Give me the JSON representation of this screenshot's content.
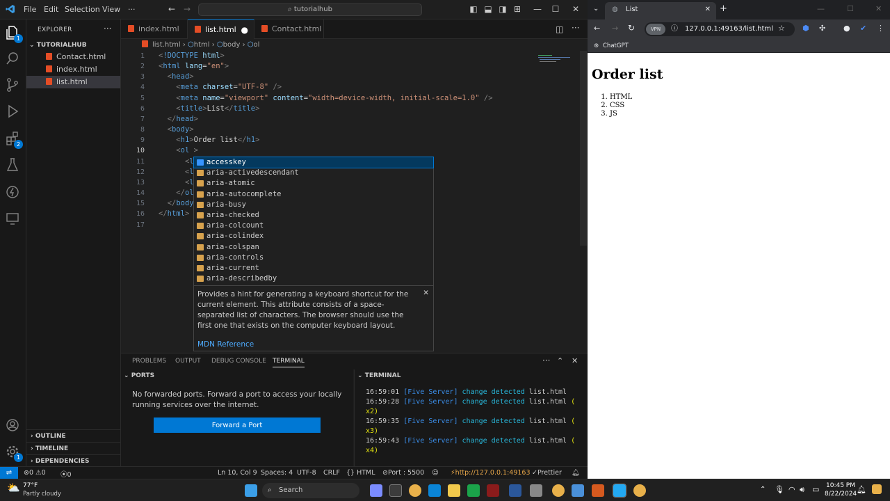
{
  "vscode": {
    "menu": [
      "File",
      "Edit",
      "Selection",
      "View",
      "···"
    ],
    "command_center": "tutorialhub",
    "explorer": {
      "header": "EXPLORER",
      "folder": "TUTORIALHUB",
      "files": [
        "Contact.html",
        "index.html",
        "list.html"
      ],
      "sections": [
        "OUTLINE",
        "TIMELINE",
        "DEPENDENCIES"
      ]
    },
    "activity_badges": {
      "explorer": "1",
      "extensions": "2"
    },
    "tabs": [
      "index.html",
      "list.html",
      "Contact.html"
    ],
    "breadcrumb": [
      "list.html",
      "html",
      "body",
      "ol"
    ],
    "line_numbers": [
      "1",
      "2",
      "3",
      "4",
      "5",
      "6",
      "7",
      "8",
      "9",
      "10",
      "11",
      "12",
      "13",
      "14",
      "15",
      "16",
      "17"
    ],
    "suggestions": [
      "accesskey",
      "aria-activedescendant",
      "aria-atomic",
      "aria-autocomplete",
      "aria-busy",
      "aria-checked",
      "aria-colcount",
      "aria-colindex",
      "aria-colspan",
      "aria-controls",
      "aria-current",
      "aria-describedby"
    ],
    "docs": {
      "text": "Provides a hint for generating a keyboard shortcut for the current element. This attribute consists of a space-separated list of characters. The browser should use the first one that exists on the computer keyboard layout.",
      "link": "MDN Reference"
    },
    "panel_tabs": [
      "PROBLEMS",
      "OUTPUT",
      "DEBUG CONSOLE",
      "TERMINAL"
    ],
    "ports": {
      "header": "PORTS",
      "message": "No forwarded ports. Forward a port to access your locally running services over the internet.",
      "button": "Forward a Port"
    },
    "terminal": {
      "header": "TERMINAL",
      "lines": [
        {
          "time": "16:59:01",
          "server": "[Five Server]",
          "msg": "change detected",
          "file": "list.html",
          "extra": ""
        },
        {
          "time": "16:59:28",
          "server": "[Five Server]",
          "msg": "change detected",
          "file": "list.html",
          "extra": "(",
          "cont": "x2)"
        },
        {
          "time": "16:59:35",
          "server": "[Five Server]",
          "msg": "change detected",
          "file": "list.html",
          "extra": "(",
          "cont": "x3)"
        },
        {
          "time": "16:59:43",
          "server": "[Five Server]",
          "msg": "change detected",
          "file": "list.html",
          "extra": "(",
          "cont": "x4)"
        }
      ]
    },
    "status": {
      "errors": "0",
      "warnings": "0",
      "ports_count": "0",
      "position": "Ln 10, Col 9",
      "spaces": "Spaces: 4",
      "encoding": "UTF-8",
      "eol": "CRLF",
      "language": "HTML",
      "port": "Port : 5500",
      "live_url": "http://127.0.0.1:49163",
      "prettier": "Prettier"
    }
  },
  "browser": {
    "tab_title": "List",
    "url": "127.0.0.1:49163/list.html",
    "bookmark": "ChatGPT",
    "vpn_label": "VPN",
    "page_heading": "Order list",
    "list_items": [
      "HTML",
      "CSS",
      "JS"
    ]
  },
  "taskbar": {
    "weather_temp": "77°F",
    "weather_desc": "Partly cloudy",
    "search": "Search",
    "time": "10:45 PM",
    "date": "8/22/2024"
  }
}
